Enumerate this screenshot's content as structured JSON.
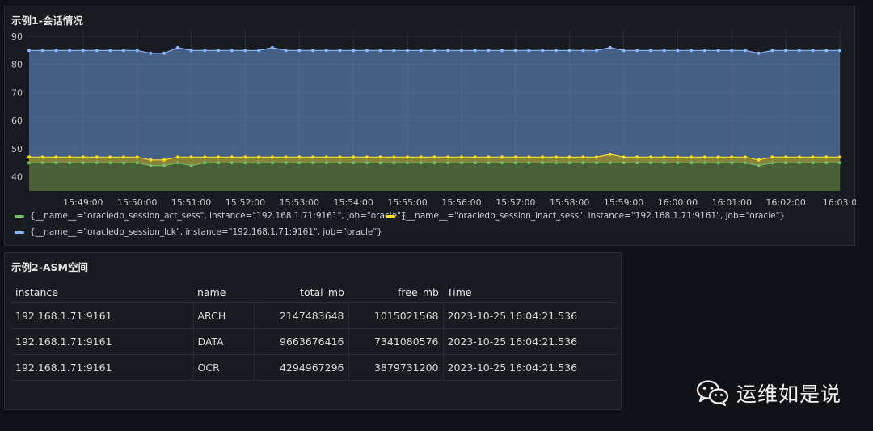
{
  "panel1": {
    "title": "示例1-会话情况",
    "legend": [
      {
        "label": "{__name__=\"oracledb_session_act_sess\", instance=\"192.168.1.71:9161\", job=\"oracle\"}",
        "color": "#73bf69"
      },
      {
        "label": "{__name__=\"oracledb_session_inact_sess\", instance=\"192.168.1.71:9161\", job=\"oracle\"}",
        "color": "#fade2a"
      },
      {
        "label": "{__name__=\"oracledb_session_lck\", instance=\"192.168.1.71:9161\", job=\"oracle\"}",
        "color": "#8ab8ff"
      }
    ]
  },
  "chart_data": {
    "type": "area",
    "title": "示例1-会话情况",
    "x": [
      "15:48:00",
      "15:48:15",
      "15:48:30",
      "15:48:45",
      "15:49:00",
      "15:49:15",
      "15:49:30",
      "15:49:45",
      "15:50:00",
      "15:50:15",
      "15:50:30",
      "15:50:45",
      "15:51:00",
      "15:51:15",
      "15:51:30",
      "15:51:45",
      "15:52:00",
      "15:52:15",
      "15:52:30",
      "15:52:45",
      "15:53:00",
      "15:53:15",
      "15:53:30",
      "15:53:45",
      "15:54:00",
      "15:54:15",
      "15:54:30",
      "15:54:45",
      "15:55:00",
      "15:55:15",
      "15:55:30",
      "15:55:45",
      "15:56:00",
      "15:56:15",
      "15:56:30",
      "15:56:45",
      "15:57:00",
      "15:57:15",
      "15:57:30",
      "15:57:45",
      "15:58:00",
      "15:58:15",
      "15:58:30",
      "15:58:45",
      "15:59:00",
      "15:59:15",
      "15:59:30",
      "15:59:45",
      "16:00:00",
      "16:00:15",
      "16:00:30",
      "16:00:45",
      "16:01:00",
      "16:01:15",
      "16:01:30",
      "16:01:45",
      "16:02:00",
      "16:02:15",
      "16:02:30",
      "16:02:45",
      "16:03:00"
    ],
    "x_tick_labels": [
      "15:49:00",
      "15:50:00",
      "15:51:00",
      "15:52:00",
      "15:53:00",
      "15:54:00",
      "15:55:00",
      "15:56:00",
      "15:57:00",
      "15:58:00",
      "15:59:00",
      "16:00:00",
      "16:01:00",
      "16:02:00",
      "16:03:0"
    ],
    "ylim": [
      35,
      92
    ],
    "y_ticks": [
      40,
      50,
      60,
      70,
      80,
      90
    ],
    "grid": true,
    "legend_position": "bottom",
    "series": [
      {
        "name": "{__name__=\"oracledb_session_lck\", instance=\"192.168.1.71:9161\", job=\"oracle\"}",
        "color": "#8ab8ff",
        "values": [
          85,
          85,
          85,
          85,
          85,
          85,
          85,
          85,
          85,
          84,
          84,
          86,
          85,
          85,
          85,
          85,
          85,
          85,
          86,
          85,
          85,
          85,
          85,
          85,
          85,
          85,
          85,
          85,
          85,
          85,
          85,
          85,
          85,
          85,
          85,
          85,
          85,
          85,
          85,
          85,
          85,
          85,
          85,
          86,
          85,
          85,
          85,
          85,
          85,
          85,
          85,
          85,
          85,
          85,
          84,
          85,
          85,
          85,
          85,
          85,
          85
        ]
      },
      {
        "name": "{__name__=\"oracledb_session_inact_sess\", instance=\"192.168.1.71:9161\", job=\"oracle\"}",
        "color": "#fade2a",
        "values": [
          47,
          47,
          47,
          47,
          47,
          47,
          47,
          47,
          47,
          46,
          46,
          47,
          47,
          47,
          47,
          47,
          47,
          47,
          47,
          47,
          47,
          47,
          47,
          47,
          47,
          47,
          47,
          47,
          47,
          47,
          47,
          47,
          47,
          47,
          47,
          47,
          47,
          47,
          47,
          47,
          47,
          47,
          47,
          48,
          47,
          47,
          47,
          47,
          47,
          47,
          47,
          47,
          47,
          47,
          46,
          47,
          47,
          47,
          47,
          47,
          47
        ]
      },
      {
        "name": "{__name__=\"oracledb_session_act_sess\", instance=\"192.168.1.71:9161\", job=\"oracle\"}",
        "color": "#73bf69",
        "values": [
          45,
          45,
          45,
          45,
          45,
          45,
          45,
          45,
          45,
          44,
          44,
          45,
          44,
          45,
          45,
          45,
          45,
          45,
          45,
          45,
          45,
          45,
          45,
          45,
          45,
          45,
          45,
          45,
          45,
          45,
          45,
          45,
          45,
          45,
          45,
          45,
          45,
          45,
          45,
          45,
          45,
          45,
          45,
          45,
          45,
          45,
          45,
          45,
          45,
          45,
          45,
          45,
          45,
          45,
          44,
          45,
          45,
          45,
          45,
          45,
          45
        ]
      }
    ]
  },
  "panel2": {
    "title": "示例2-ASM空间",
    "columns": [
      "instance",
      "name",
      "total_mb",
      "free_mb",
      "Time"
    ],
    "rows": [
      [
        "192.168.1.71:9161",
        "ARCH",
        "2147483648",
        "1015021568",
        "2023-10-25 16:04:21.536"
      ],
      [
        "192.168.1.71:9161",
        "DATA",
        "9663676416",
        "7341080576",
        "2023-10-25 16:04:21.536"
      ],
      [
        "192.168.1.71:9161",
        "OCR",
        "4294967296",
        "3879731200",
        "2023-10-25 16:04:21.536"
      ]
    ]
  },
  "watermark": {
    "text": "运维如是说",
    "icon": "wechat-icon"
  }
}
